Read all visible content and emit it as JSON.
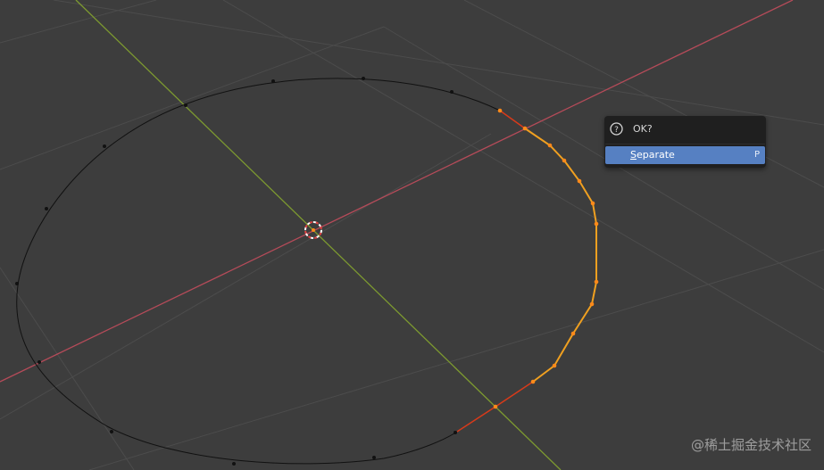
{
  "popup": {
    "title": "OK?",
    "title_icon": "question-circle-icon",
    "items": [
      {
        "label": "Separate",
        "shortcut": "P",
        "active": true
      }
    ]
  },
  "watermark": "@稀土掘金技术社区",
  "colors": {
    "viewport_bg": "#3d3d3d",
    "grid_line": "#4d4d4d",
    "x_axis": "#b54b59",
    "y_axis": "#7d9a30",
    "curve": "#111111",
    "selected_segment": "#f0a020",
    "selected_point": "#ff8a1a",
    "partial_segment": "#d83a1a",
    "menu_highlight": "#5680c2",
    "popup_bg": "#1f1f1f"
  }
}
